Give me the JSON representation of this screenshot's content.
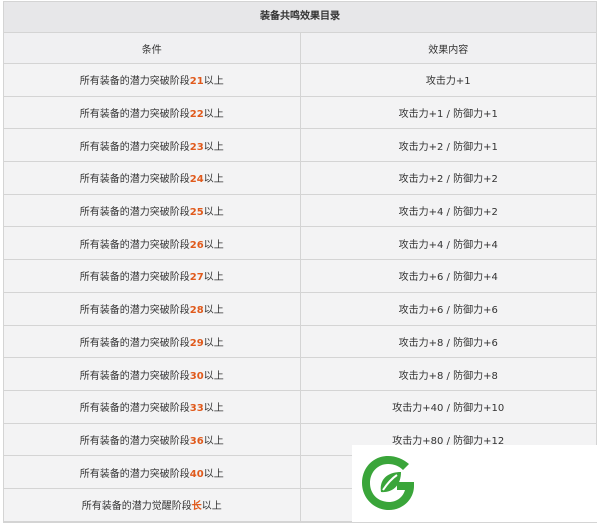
{
  "table": {
    "caption": "装备共鸣效果目录",
    "headers": [
      "条件",
      "效果内容"
    ],
    "condition_prefix": "所有装备的潜力突破阶段",
    "awaken_prefix": "所有装备的潜力觉醒阶段",
    "condition_suffix": "以上",
    "rows": [
      {
        "prefix": "所有装备的潜力突破阶段",
        "stage": "21",
        "suffix": "以上",
        "effect": "攻击力+1"
      },
      {
        "prefix": "所有装备的潜力突破阶段",
        "stage": "22",
        "suffix": "以上",
        "effect": "攻击力+1 / 防御力+1"
      },
      {
        "prefix": "所有装备的潜力突破阶段",
        "stage": "23",
        "suffix": "以上",
        "effect": "攻击力+2 / 防御力+1"
      },
      {
        "prefix": "所有装备的潜力突破阶段",
        "stage": "24",
        "suffix": "以上",
        "effect": "攻击力+2 / 防御力+2"
      },
      {
        "prefix": "所有装备的潜力突破阶段",
        "stage": "25",
        "suffix": "以上",
        "effect": "攻击力+4 / 防御力+2"
      },
      {
        "prefix": "所有装备的潜力突破阶段",
        "stage": "26",
        "suffix": "以上",
        "effect": "攻击力+4 / 防御力+4"
      },
      {
        "prefix": "所有装备的潜力突破阶段",
        "stage": "27",
        "suffix": "以上",
        "effect": "攻击力+6 / 防御力+4"
      },
      {
        "prefix": "所有装备的潜力突破阶段",
        "stage": "28",
        "suffix": "以上",
        "effect": "攻击力+6 / 防御力+6"
      },
      {
        "prefix": "所有装备的潜力突破阶段",
        "stage": "29",
        "suffix": "以上",
        "effect": "攻击力+8 / 防御力+6"
      },
      {
        "prefix": "所有装备的潜力突破阶段",
        "stage": "30",
        "suffix": "以上",
        "effect": "攻击力+8 / 防御力+8"
      },
      {
        "prefix": "所有装备的潜力突破阶段",
        "stage": "33",
        "suffix": "以上",
        "effect": "攻击力+40 / 防御力+10"
      },
      {
        "prefix": "所有装备的潜力突破阶段",
        "stage": "36",
        "suffix": "以上",
        "effect": "攻击力+80 / 防御力+12"
      },
      {
        "prefix": "所有装备的潜力突破阶段",
        "stage": "40",
        "suffix": "以上",
        "effect": ""
      },
      {
        "prefix": "所有装备的潜力觉醒阶段",
        "stage": "长",
        "suffix": "以上",
        "effect": ""
      }
    ]
  },
  "colors": {
    "stage_highlight": "#e05a1c",
    "logo_green": "#3aa53a"
  },
  "watermark": {
    "icon": "leaf-logo-icon"
  }
}
